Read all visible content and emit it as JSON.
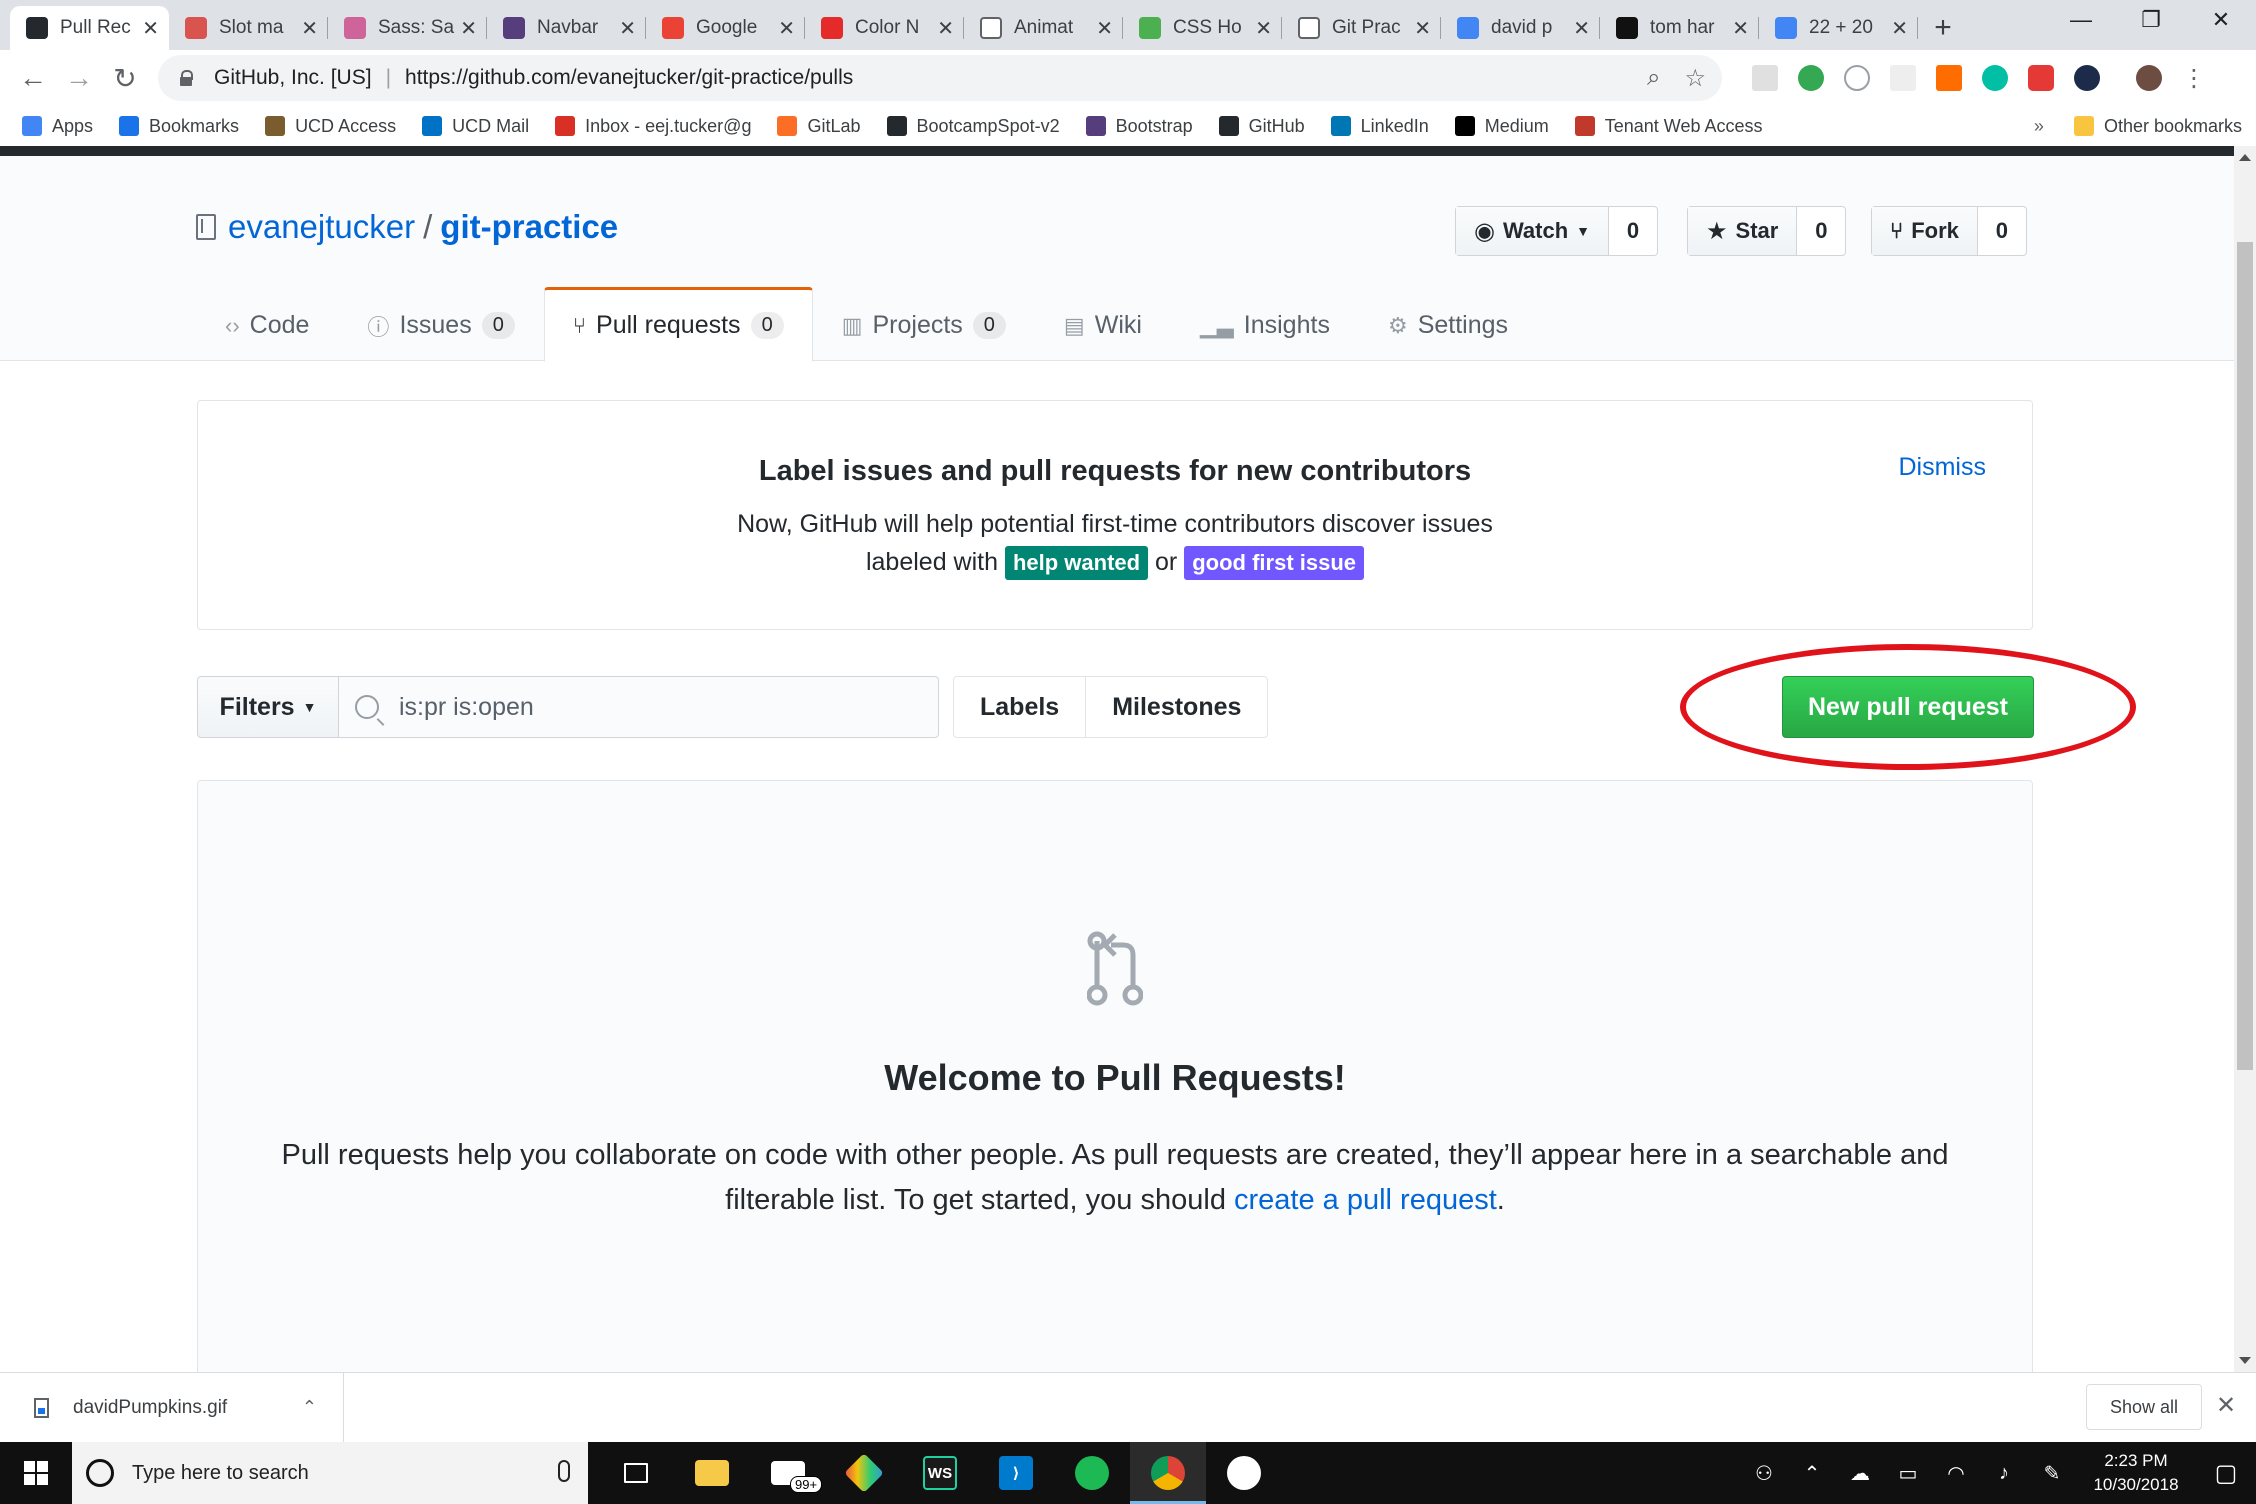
{
  "browser": {
    "tabs": [
      {
        "title": "Pull Rec",
        "icon": "github-icon",
        "color": "#24292e",
        "active": true
      },
      {
        "title": "Slot ma",
        "icon": "slot-machine-icon",
        "color": "#d9534f"
      },
      {
        "title": "Sass: Sa",
        "icon": "sass-icon",
        "color": "#cf649a"
      },
      {
        "title": "Navbar",
        "icon": "bootstrap-icon",
        "color": "#563d7c"
      },
      {
        "title": "Google",
        "icon": "google-fonts-icon",
        "color": "#ea4335"
      },
      {
        "title": "Color N",
        "icon": "opera-icon",
        "color": "#e52a2a"
      },
      {
        "title": "Animat",
        "icon": "page-icon",
        "color": "#ffffff"
      },
      {
        "title": "CSS Ho",
        "icon": "css-icon",
        "color": "#4caf50"
      },
      {
        "title": "Git Prac",
        "icon": "doc-icon",
        "color": "#ffffff"
      },
      {
        "title": "david p",
        "icon": "google-icon",
        "color": "#4285f4"
      },
      {
        "title": "tom har",
        "icon": "imdb-icon",
        "color": "#111111"
      },
      {
        "title": "22 + 20",
        "icon": "google-icon",
        "color": "#4285f4"
      }
    ],
    "site_identity": "GitHub, Inc. [US]",
    "url": "https://github.com/evanejtucker/git-practice/pulls",
    "bookmarks": [
      {
        "label": "Apps",
        "icon": "apps-grid-icon",
        "color": "#4285f4"
      },
      {
        "label": "Bookmarks",
        "icon": "star-icon",
        "color": "#1a73e8"
      },
      {
        "label": "UCD Access",
        "icon": "ucd-icon",
        "color": "#7a5c2e"
      },
      {
        "label": "UCD Mail",
        "icon": "outlook-icon",
        "color": "#0072c6"
      },
      {
        "label": "Inbox - eej.tucker@g",
        "icon": "gmail-icon",
        "color": "#d93025"
      },
      {
        "label": "GitLab",
        "icon": "gitlab-icon",
        "color": "#fc6d26"
      },
      {
        "label": "BootcampSpot-v2",
        "icon": "shield-icon",
        "color": "#24292e"
      },
      {
        "label": "Bootstrap",
        "icon": "bootstrap-icon",
        "color": "#563d7c"
      },
      {
        "label": "GitHub",
        "icon": "github-icon",
        "color": "#24292e"
      },
      {
        "label": "LinkedIn",
        "icon": "linkedin-icon",
        "color": "#0077b5"
      },
      {
        "label": "Medium",
        "icon": "medium-icon",
        "color": "#000000"
      },
      {
        "label": "Tenant Web Access",
        "icon": "tenant-icon",
        "color": "#c0392b"
      }
    ],
    "more_bookmarks": "»",
    "other_bookmarks": "Other bookmarks"
  },
  "repo": {
    "owner": "evanejtucker",
    "separator": "/",
    "name": "git-practice",
    "watch_label": "Watch",
    "watch_count": "0",
    "star_label": "Star",
    "star_count": "0",
    "fork_label": "Fork",
    "fork_count": "0",
    "nav": [
      {
        "label": "Code",
        "icon": "code-icon"
      },
      {
        "label": "Issues",
        "icon": "issue-icon",
        "count": "0"
      },
      {
        "label": "Pull requests",
        "icon": "pull-request-icon",
        "count": "0",
        "selected": true
      },
      {
        "label": "Projects",
        "icon": "project-icon",
        "count": "0"
      },
      {
        "label": "Wiki",
        "icon": "book-icon"
      },
      {
        "label": "Insights",
        "icon": "graph-icon"
      },
      {
        "label": "Settings",
        "icon": "gear-icon"
      }
    ]
  },
  "notice": {
    "title": "Label issues and pull requests for new contributors",
    "line1": "Now, GitHub will help potential first-time contributors discover issues",
    "line2_prefix": "labeled with",
    "label_help": "help wanted",
    "label_help_color": "#008672",
    "or_text": "or",
    "label_first": "good first issue",
    "label_first_color": "#7057ff",
    "dismiss": "Dismiss"
  },
  "filters": {
    "filters_label": "Filters",
    "search_value": "is:pr is:open",
    "labels_label": "Labels",
    "milestones_label": "Milestones",
    "new_pr_label": "New pull request",
    "new_pr_color": "#28a745",
    "highlight_color": "#e0131b"
  },
  "blankslate": {
    "title": "Welcome to Pull Requests!",
    "text_before": "Pull requests help you collaborate on code with other people. As pull requests are created, they’ll appear here in a searchable and filterable list. To get started, you should",
    "link": "create a pull request",
    "text_after": "."
  },
  "downloads": {
    "file": "davidPumpkins.gif",
    "show_all": "Show all"
  },
  "taskbar": {
    "search_placeholder": "Type here to search",
    "mail_badge": "99+",
    "time": "2:23 PM",
    "date": "10/30/2018"
  }
}
